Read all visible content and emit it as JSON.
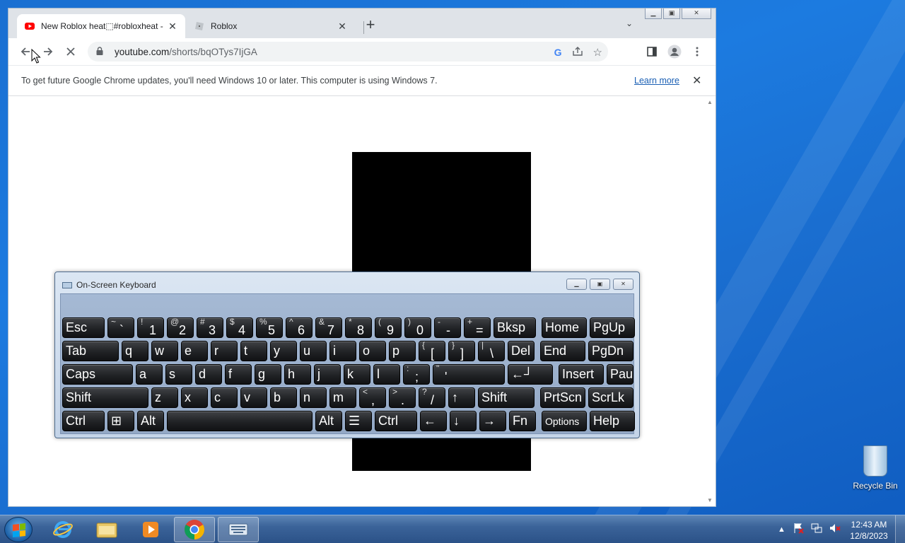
{
  "browser": {
    "tabs": [
      {
        "title": "New Roblox heat⬚#robloxheat -",
        "favicon": "youtube-icon"
      },
      {
        "title": "Roblox",
        "favicon": "roblox-icon"
      }
    ],
    "url_host": "youtube.com",
    "url_path": "/shorts/bqOTys7IjGA",
    "infobar": {
      "message": "To get future Google Chrome updates, you'll need Windows 10 or later. This computer is using Windows 7.",
      "link": "Learn more"
    }
  },
  "osk": {
    "title": "On-Screen Keyboard",
    "rows": [
      [
        {
          "main": "Esc"
        },
        {
          "top": "~",
          "main": "`"
        },
        {
          "top": "!",
          "main": "1"
        },
        {
          "top": "@",
          "main": "2"
        },
        {
          "top": "#",
          "main": "3"
        },
        {
          "top": "$",
          "main": "4"
        },
        {
          "top": "%",
          "main": "5"
        },
        {
          "top": "^",
          "main": "6"
        },
        {
          "top": "&",
          "main": "7"
        },
        {
          "top": "*",
          "main": "8"
        },
        {
          "top": "(",
          "main": "9"
        },
        {
          "top": ")",
          "main": "0"
        },
        {
          "top": "-",
          "main": "-"
        },
        {
          "top": "+",
          "main": "="
        },
        {
          "main": "Bksp"
        },
        {
          "main": "Home"
        },
        {
          "main": "PgUp"
        }
      ],
      [
        {
          "main": "Tab"
        },
        {
          "main": "q"
        },
        {
          "main": "w"
        },
        {
          "main": "e"
        },
        {
          "main": "r"
        },
        {
          "main": "t"
        },
        {
          "main": "y"
        },
        {
          "main": "u"
        },
        {
          "main": "i"
        },
        {
          "main": "o"
        },
        {
          "main": "p"
        },
        {
          "top": "{",
          "main": "["
        },
        {
          "top": "}",
          "main": "]"
        },
        {
          "top": "|",
          "main": "\\"
        },
        {
          "main": "Del"
        },
        {
          "main": "End"
        },
        {
          "main": "PgDn"
        }
      ],
      [
        {
          "main": "Caps"
        },
        {
          "main": "a"
        },
        {
          "main": "s"
        },
        {
          "main": "d"
        },
        {
          "main": "f"
        },
        {
          "main": "g"
        },
        {
          "main": "h"
        },
        {
          "main": "j"
        },
        {
          "main": "k"
        },
        {
          "main": "l"
        },
        {
          "top": ":",
          "main": ";"
        },
        {
          "top": "\"",
          "main": "'"
        },
        {
          "main": "←┘"
        },
        {
          "main": "Insert"
        },
        {
          "main": "Pause"
        }
      ],
      [
        {
          "main": "Shift"
        },
        {
          "main": "z"
        },
        {
          "main": "x"
        },
        {
          "main": "c"
        },
        {
          "main": "v"
        },
        {
          "main": "b"
        },
        {
          "main": "n"
        },
        {
          "main": "m"
        },
        {
          "top": "<",
          "main": ","
        },
        {
          "top": ">",
          "main": "."
        },
        {
          "top": "?",
          "main": "/"
        },
        {
          "main": "↑"
        },
        {
          "main": "Shift"
        },
        {
          "main": "PrtScn"
        },
        {
          "main": "ScrLk"
        }
      ],
      [
        {
          "main": "Ctrl"
        },
        {
          "main": "⊞"
        },
        {
          "main": "Alt"
        },
        {
          "main": ""
        },
        {
          "main": "Alt"
        },
        {
          "main": "☰"
        },
        {
          "main": "Ctrl"
        },
        {
          "main": "←"
        },
        {
          "main": "↓"
        },
        {
          "main": "→"
        },
        {
          "main": "Fn"
        },
        {
          "main": "Options"
        },
        {
          "main": "Help"
        }
      ]
    ]
  },
  "desktop": {
    "recycle_bin": "Recycle Bin"
  },
  "taskbar": {
    "apps": [
      "ie-icon",
      "explorer-icon",
      "media-player-icon",
      "chrome-icon",
      "osk-icon"
    ],
    "time": "12:43 AM",
    "date": "12/8/2023"
  },
  "colors": {
    "desktop": "#1a6fd1",
    "taskbar": "#3b6399",
    "youtube_red": "#ff0000",
    "link": "#1a5fb4"
  }
}
